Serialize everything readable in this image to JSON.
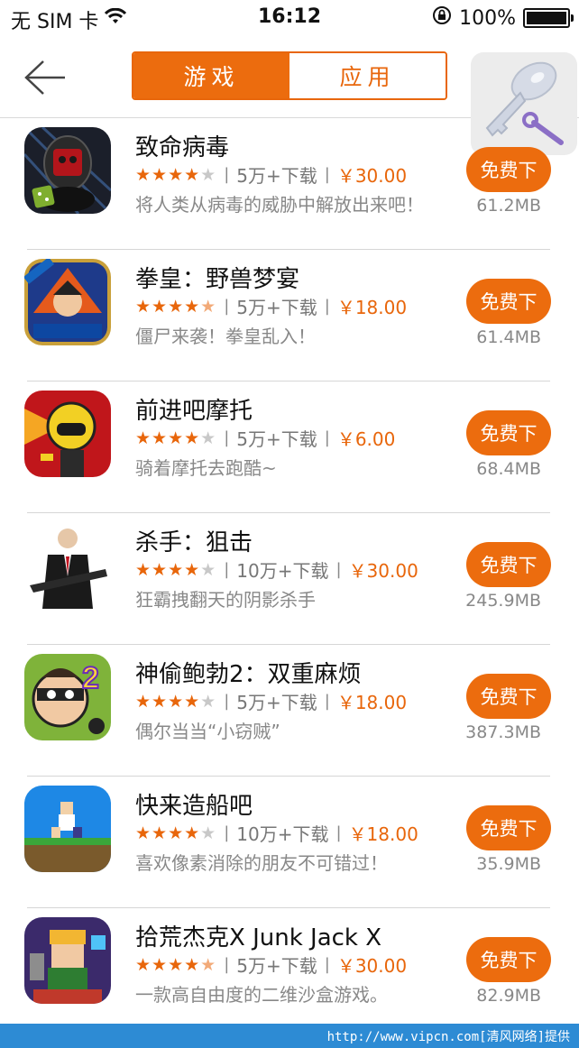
{
  "status_bar": {
    "carrier": "无 SIM 卡",
    "time": "16:12",
    "battery": "100%"
  },
  "nav": {
    "tabs": [
      {
        "label": "游戏",
        "active": true
      },
      {
        "label": "应用",
        "active": false
      }
    ]
  },
  "accent_color": "#ec6c0e",
  "apps": [
    {
      "name": "致命病毒",
      "rating": 4,
      "downloads": "5万+下载",
      "price": "￥30.00",
      "desc": "将人类从病毒的威胁中解放出来吧！",
      "button": "免费下",
      "size": "61.2MB"
    },
    {
      "name": "拳皇：野兽梦宴",
      "rating": 4.5,
      "downloads": "5万+下载",
      "price": "￥18.00",
      "desc": "僵尸来袭！拳皇乱入！",
      "button": "免费下",
      "size": "61.4MB"
    },
    {
      "name": "前进吧摩托",
      "rating": 4,
      "downloads": "5万+下载",
      "price": "￥6.00",
      "desc": "骑着摩托去跑酷~",
      "button": "免费下",
      "size": "68.4MB"
    },
    {
      "name": "杀手：狙击",
      "rating": 4,
      "downloads": "10万+下载",
      "price": "￥30.00",
      "desc": "狂霸拽翻天的阴影杀手",
      "button": "免费下",
      "size": "245.9MB"
    },
    {
      "name": "神偷鲍勃2：双重麻烦",
      "rating": 4,
      "downloads": "5万+下载",
      "price": "￥18.00",
      "desc": "偶尔当当“小窃贼”",
      "button": "免费下",
      "size": "387.3MB"
    },
    {
      "name": "快来造船吧",
      "rating": 4,
      "downloads": "10万+下载",
      "price": "￥18.00",
      "desc": "喜欢像素消除的朋友不可错过！",
      "button": "免费下",
      "size": "35.9MB"
    },
    {
      "name": "拾荒杰克X Junk Jack X",
      "rating": 4.5,
      "downloads": "5万+下载",
      "price": "￥30.00",
      "desc": "一款高自由度的二维沙盒游戏。",
      "button": "免费下",
      "size": "82.9MB"
    }
  ],
  "watermark": "http://www.vipcn.com[清风网络]提供"
}
